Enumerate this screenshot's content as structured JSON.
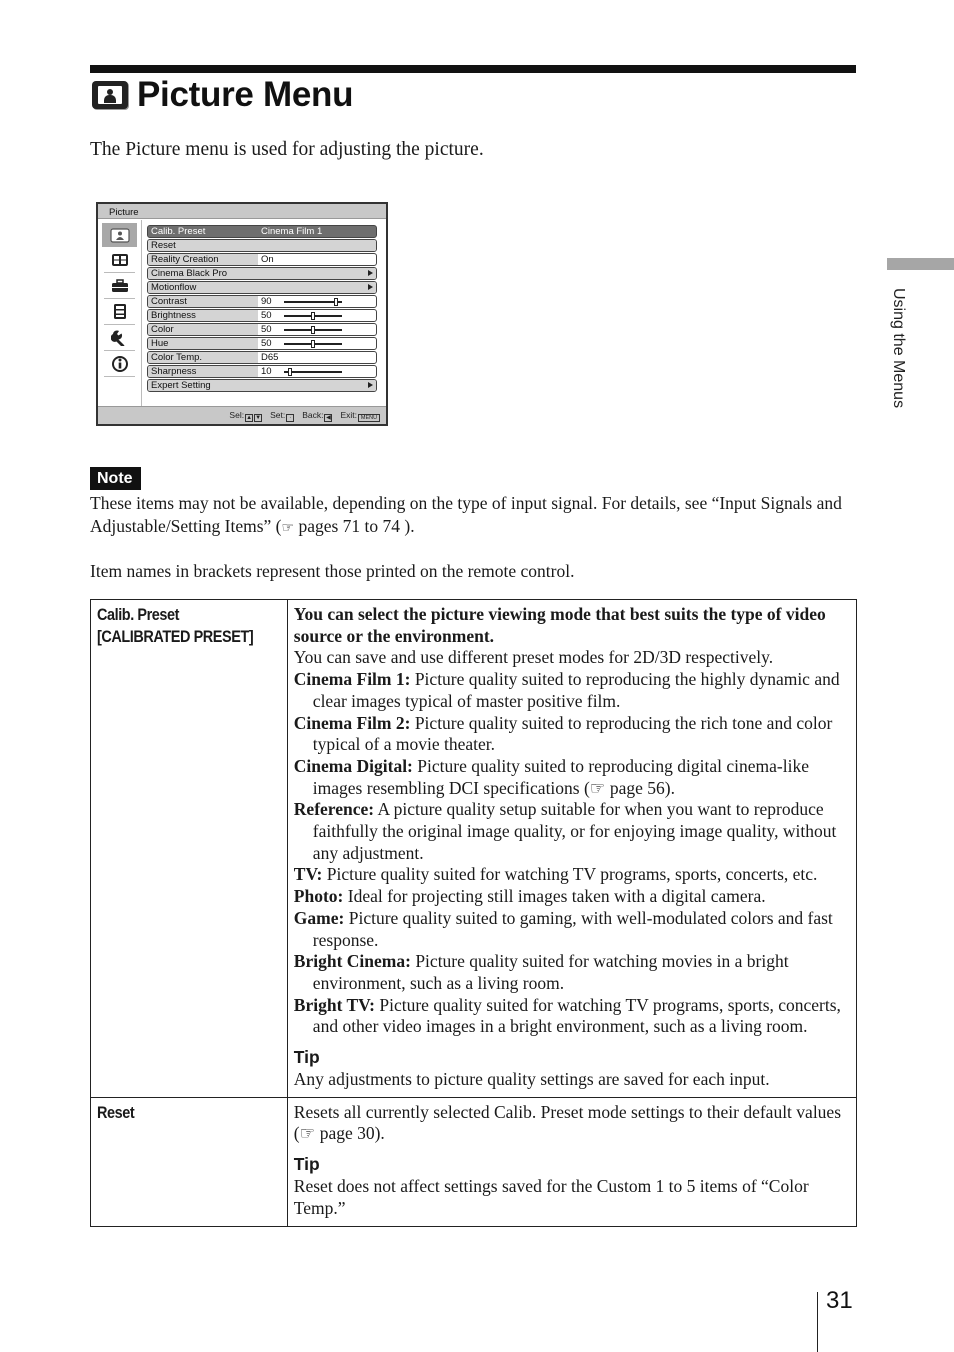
{
  "header": {
    "title": "Picture Menu",
    "title_icon": "picture-menu-icon",
    "intro": "The Picture menu is used for adjusting the picture."
  },
  "osd": {
    "header": "Picture",
    "sidebar_icons": [
      "picture-icon",
      "screen-icon",
      "function-icon",
      "operation-icon",
      "setup-icon",
      "information-icon"
    ],
    "rows": [
      {
        "label": "Calib. Preset",
        "value": "Cinema Film 1",
        "selected": true
      },
      {
        "label": "Reset",
        "value": ""
      },
      {
        "label": "Reality Creation",
        "value": "On"
      },
      {
        "label": "Cinema Black Pro",
        "value": "",
        "submenu": true
      },
      {
        "label": "Motionflow",
        "value": "",
        "submenu": true
      },
      {
        "label": "Contrast",
        "value": "90",
        "slider": 0.9
      },
      {
        "label": "Brightness",
        "value": "50",
        "slider": 0.5
      },
      {
        "label": "Color",
        "value": "50",
        "slider": 0.5
      },
      {
        "label": "Hue",
        "value": "50",
        "slider": 0.5
      },
      {
        "label": "Color Temp.",
        "value": "D65"
      },
      {
        "label": "Sharpness",
        "value": "10",
        "slider": 0.1
      },
      {
        "label": "Expert Setting",
        "value": "",
        "submenu": true
      }
    ],
    "footer": {
      "sel": "Sel:",
      "set": "Set:",
      "back": "Back:",
      "exit": "Exit:",
      "menu_key": "MENU"
    }
  },
  "side_tab": {
    "label": "Using the Menus"
  },
  "note": {
    "badge": "Note",
    "text_before": "These items may not be available, depending on the type of input signal. For details, see “Input Signals and Adjustable/Setting Items” (",
    "ref_icon": "☞",
    "text_after": " pages 71 to 74 )."
  },
  "bracket_note": "Item names in brackets represent those printed on the remote control.",
  "table": {
    "calib": {
      "term_line1": "Calib. Preset",
      "term_line2": "[CALIBRATED PRESET]",
      "lead": "You can select the picture viewing mode that best suits the type of video source or the environment.",
      "save_note": "You can save and use different preset modes for 2D/3D respectively.",
      "modes": [
        {
          "name": "Cinema Film 1:",
          "text": " Picture quality suited to reproducing the highly dynamic and clear images typical of master positive film."
        },
        {
          "name": "Cinema Film 2:",
          "text": " Picture quality suited to reproducing the rich tone and color typical of a movie theater."
        },
        {
          "name": "Cinema Digital:",
          "text": " Picture quality suited to reproducing digital cinema-like images resembling DCI specifications (☞ page 56)."
        },
        {
          "name": "Reference:",
          "text": " A picture quality setup suitable for when you want to reproduce faithfully the original image quality, or for enjoying image quality, without any adjustment."
        },
        {
          "name": "TV:",
          "text": " Picture quality suited for watching TV programs, sports, concerts, etc."
        },
        {
          "name": "Photo:",
          "text": " Ideal for projecting still images taken with a digital camera."
        },
        {
          "name": "Game:",
          "text": " Picture quality suited to gaming, with well-modulated colors and fast response."
        },
        {
          "name": "Bright Cinema:",
          "text": " Picture quality suited for watching movies in a bright environment, such as a living room."
        },
        {
          "name": "Bright TV:",
          "text": " Picture quality suited for watching TV programs, sports, concerts, and other video images in a bright environment, such as a living room."
        }
      ],
      "tip_head": "Tip",
      "tip_text": "Any adjustments to picture quality settings are saved for each input."
    },
    "reset": {
      "term": "Reset",
      "text": "Resets all currently selected Calib. Preset mode settings to their default values (☞ page 30).",
      "tip_head": "Tip",
      "tip_text": "Reset does not affect settings saved for the Custom 1 to 5 items of “Color Temp.”"
    }
  },
  "footer": {
    "page_number": "31"
  }
}
